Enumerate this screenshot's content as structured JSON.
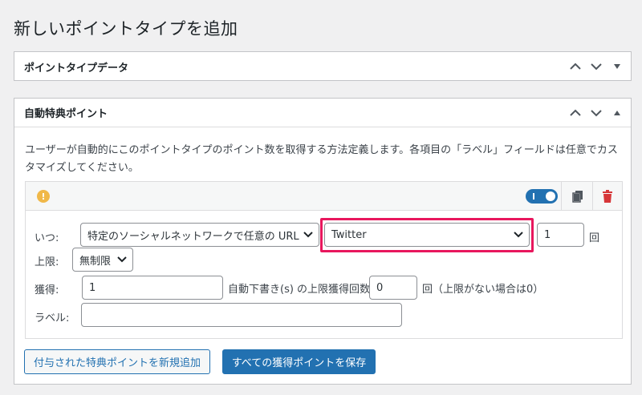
{
  "page": {
    "title": "新しいポイントタイプを追加"
  },
  "box1": {
    "title": "ポイントタイプデータ"
  },
  "box2": {
    "title": "自動特典ポイント",
    "description": "ユーザーが自動的にこのポイントタイプのポイント数を取得する方法定義します。各項目の「ラベル」フィールドは任意でカスタマイズしてください。"
  },
  "hook": {
    "enabled": true,
    "when_label": "いつ:",
    "when_value": "特定のソーシャルネットワークで任意の URL...",
    "network_value": "Twitter",
    "count_value": "1",
    "count_unit": "回",
    "limit_label": "上限:",
    "limit_value": "無制限",
    "earn_label": "獲得:",
    "earn_value": "1",
    "auto_label": "自動下書き(s) の上限獲得回数",
    "max_value": "0",
    "max_note": "回（上限がない場合は0）",
    "label_label": "ラベル:",
    "label_value": ""
  },
  "buttons": {
    "add_new": "付与された特典ポイントを新規追加",
    "save_all": "すべての獲得ポイントを保存"
  },
  "colors": {
    "primary": "#2271b1",
    "highlight": "#e8175d",
    "warning": "#f0b849",
    "danger": "#d63638"
  }
}
